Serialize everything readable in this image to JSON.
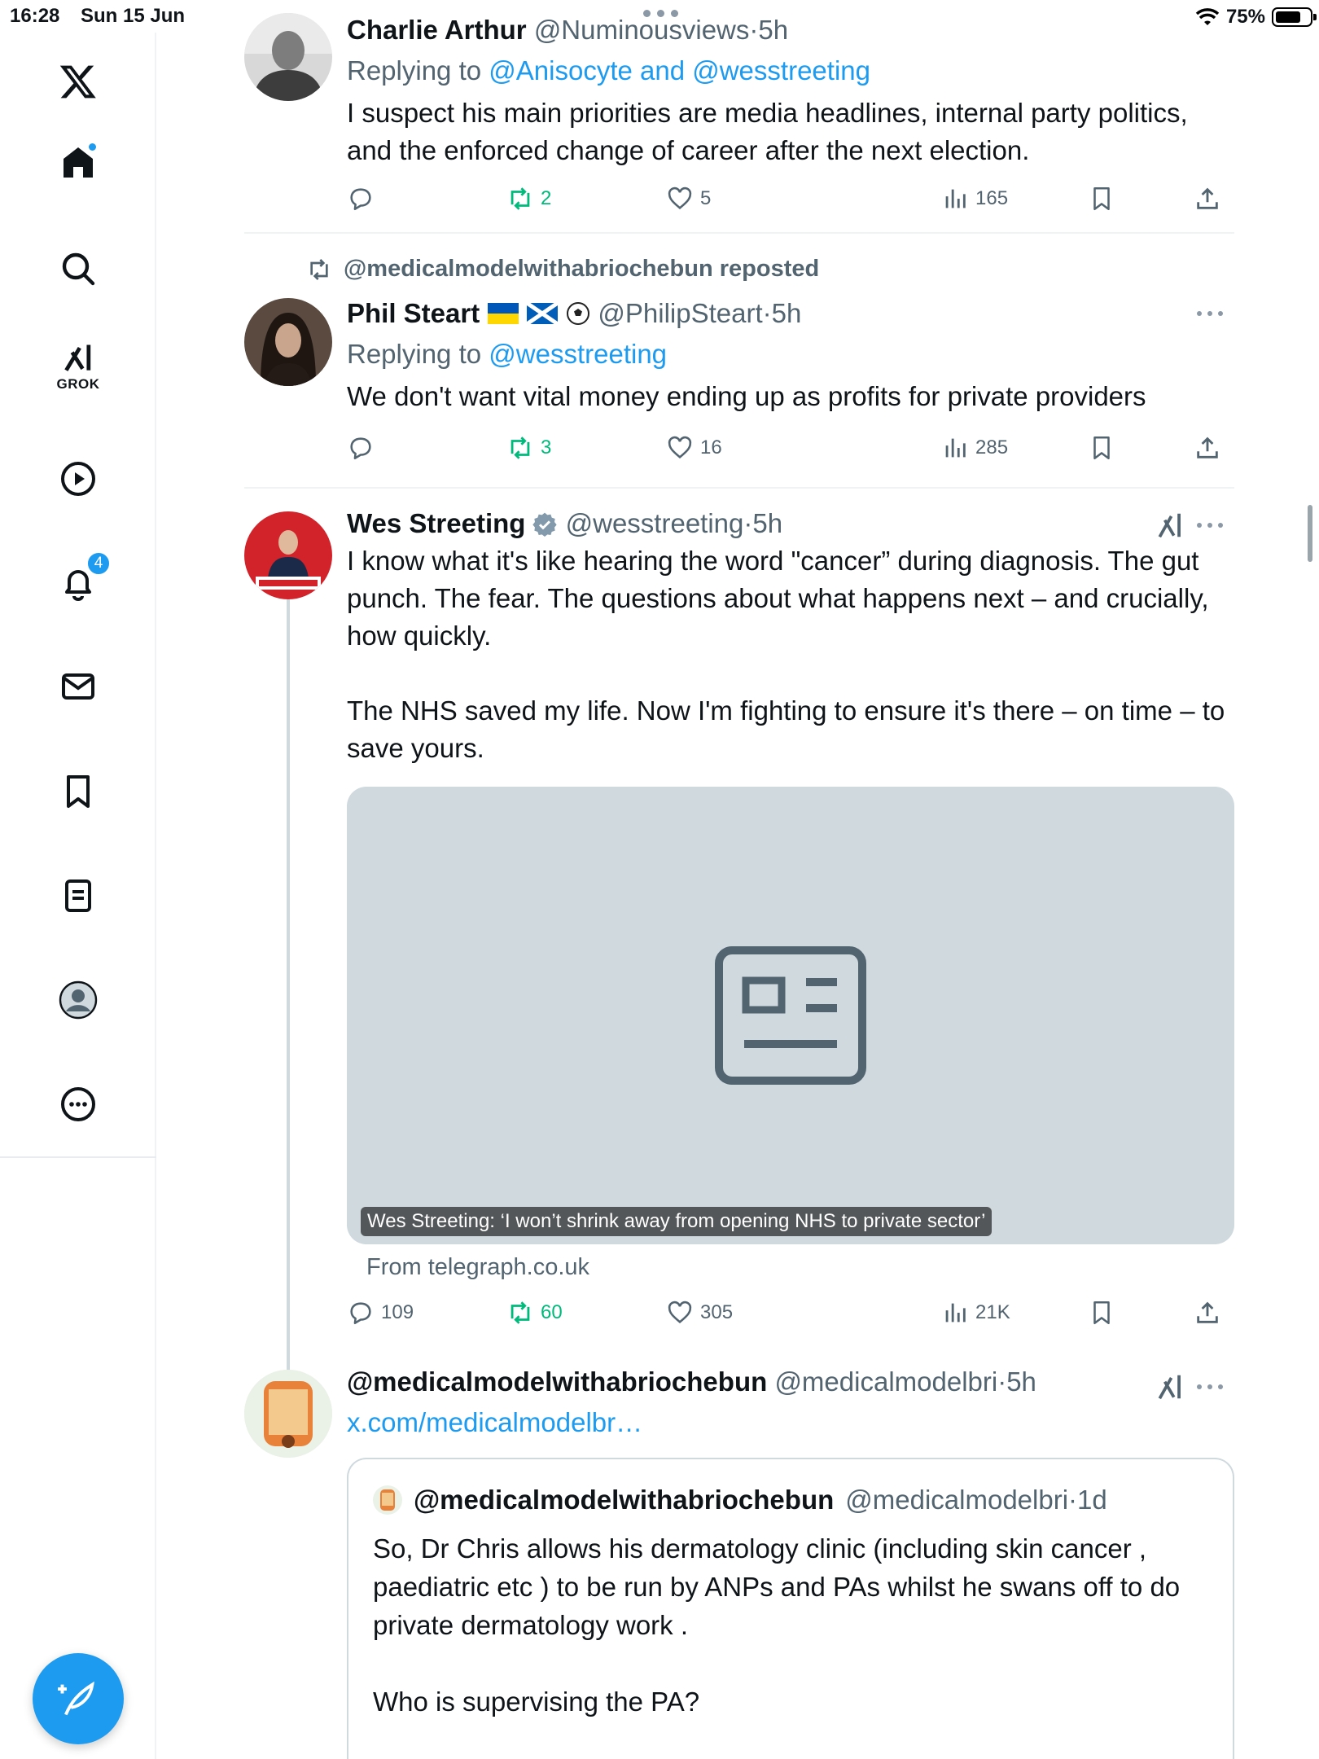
{
  "status_bar": {
    "time": "16:28",
    "date": "Sun 15 Jun",
    "battery": "75%",
    "battery_level": 0.75
  },
  "sidebar": {
    "grok_label": "GROK",
    "notifications_count": "4",
    "items": [
      "x-logo",
      "home",
      "search",
      "grok",
      "video",
      "notifications",
      "messages",
      "bookmarks",
      "lists",
      "profile",
      "more"
    ]
  },
  "tweets": [
    {
      "name": "Charlie Arthur",
      "handle": "@Numinousviews",
      "time": "5h",
      "replying_prefix": "Replying to ",
      "replying_to": "@Anisocyte and @wesstreeting",
      "text": "I suspect his main priorities are media headlines, internal party politics, and the enforced change of career after the next election.",
      "replies": "",
      "reposts": "2",
      "likes": "5",
      "views": "165"
    },
    {
      "reposted_by": "@medicalmodelwithabriochebun reposted",
      "name": "Phil Steart",
      "handle": "@PhilipSteart",
      "time": "5h",
      "replying_prefix": "Replying to ",
      "replying_to": "@wesstreeting",
      "text": "We don't want vital money ending up as profits for private providers",
      "replies": "",
      "reposts": "3",
      "likes": "16",
      "views": "285"
    },
    {
      "name": "Wes Streeting",
      "handle": "@wesstreeting",
      "time": "5h",
      "text": "I know what it's like hearing the word \"cancer” during diagnosis. The gut punch. The fear. The questions about what happens next – and crucially, how quickly.\n\nThe NHS saved my life. Now I'm fighting to ensure it's there – on time – to save yours.",
      "card_title": "Wes Streeting: ‘I won’t shrink away from opening NHS to private sector’",
      "card_source": "From telegraph.co.uk",
      "replies": "109",
      "reposts": "60",
      "likes": "305",
      "views": "21K"
    },
    {
      "name": "@medicalmodelwithabriochebun",
      "handle": "@medicalmodelbri",
      "time": "5h",
      "link": "x.com/medicalmodelbr…",
      "quote": {
        "name": "@medicalmodelwithabriochebun",
        "handle": "@medicalmodelbri",
        "time": "1d",
        "text": "So, Dr Chris allows his dermatology clinic (including skin cancer , paediatric etc ) to be run by ANPs and PAs whilst he swans off to do private dermatology work .\n\nWho is supervising the PA?"
      }
    }
  ],
  "separator": "·",
  "colors": {
    "accent": "#1d9bf0",
    "repost_green": "#00ba7c",
    "secondary_text": "#536471",
    "border": "#eff3f4"
  }
}
